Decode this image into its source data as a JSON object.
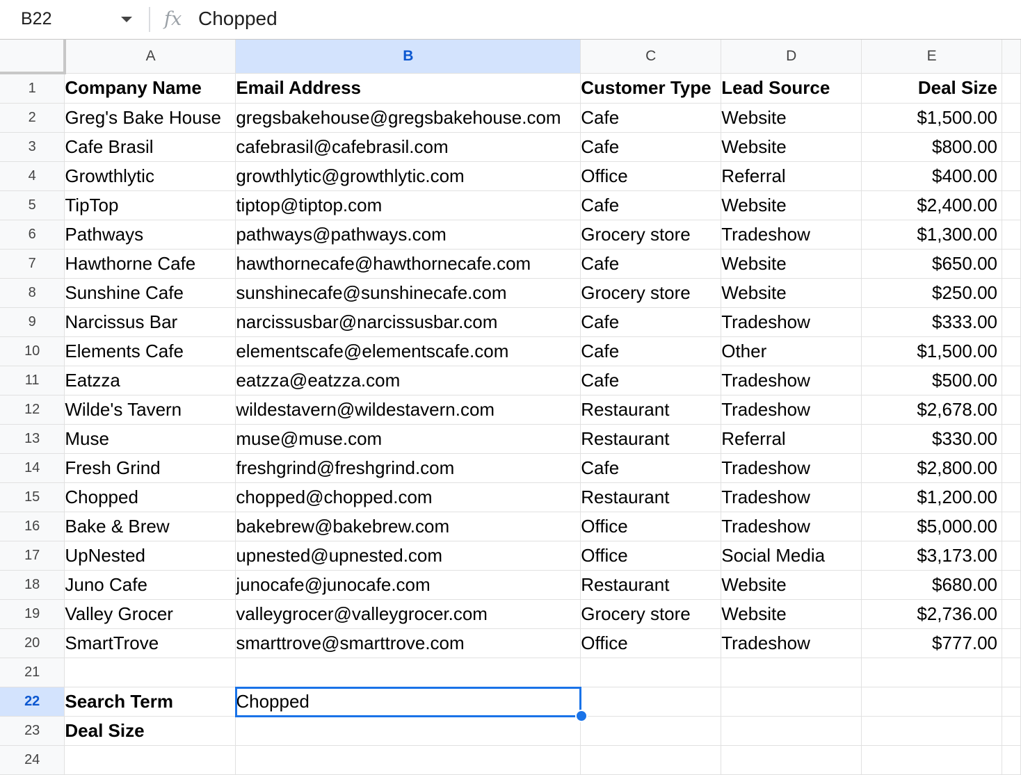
{
  "formula_bar": {
    "cell_ref": "B22",
    "fx_icon": "fx-icon",
    "content": "Chopped"
  },
  "columns": [
    "A",
    "B",
    "C",
    "D",
    "E"
  ],
  "selected_column": "B",
  "selected_row": "22",
  "rows": [
    {
      "num": "1",
      "cells": [
        "Company Name",
        "Email Address",
        "Customer Type",
        "Lead Source",
        "Deal Size"
      ]
    },
    {
      "num": "2",
      "cells": [
        "Greg's Bake House",
        "gregsbakehouse@gregsbakehouse.com",
        "Cafe",
        "Website",
        "$1,500.00"
      ]
    },
    {
      "num": "3",
      "cells": [
        "Cafe Brasil",
        "cafebrasil@cafebrasil.com",
        "Cafe",
        "Website",
        "$800.00"
      ]
    },
    {
      "num": "4",
      "cells": [
        "Growthlytic",
        "growthlytic@growthlytic.com",
        "Office",
        "Referral",
        "$400.00"
      ]
    },
    {
      "num": "5",
      "cells": [
        "TipTop",
        "tiptop@tiptop.com",
        "Cafe",
        "Website",
        "$2,400.00"
      ]
    },
    {
      "num": "6",
      "cells": [
        "Pathways",
        "pathways@pathways.com",
        "Grocery store",
        "Tradeshow",
        "$1,300.00"
      ]
    },
    {
      "num": "7",
      "cells": [
        "Hawthorne Cafe",
        "hawthornecafe@hawthornecafe.com",
        "Cafe",
        "Website",
        "$650.00"
      ]
    },
    {
      "num": "8",
      "cells": [
        "Sunshine Cafe",
        "sunshinecafe@sunshinecafe.com",
        "Grocery store",
        "Website",
        "$250.00"
      ]
    },
    {
      "num": "9",
      "cells": [
        "Narcissus Bar",
        "narcissusbar@narcissusbar.com",
        "Cafe",
        "Tradeshow",
        "$333.00"
      ]
    },
    {
      "num": "10",
      "cells": [
        "Elements Cafe",
        "elementscafe@elementscafe.com",
        "Cafe",
        "Other",
        "$1,500.00"
      ]
    },
    {
      "num": "11",
      "cells": [
        "Eatzza",
        "eatzza@eatzza.com",
        "Cafe",
        "Tradeshow",
        "$500.00"
      ]
    },
    {
      "num": "12",
      "cells": [
        "Wilde's Tavern",
        "wildestavern@wildestavern.com",
        "Restaurant",
        "Tradeshow",
        "$2,678.00"
      ]
    },
    {
      "num": "13",
      "cells": [
        "Muse",
        "muse@muse.com",
        "Restaurant",
        "Referral",
        "$330.00"
      ]
    },
    {
      "num": "14",
      "cells": [
        "Fresh Grind",
        "freshgrind@freshgrind.com",
        "Cafe",
        "Tradeshow",
        "$2,800.00"
      ]
    },
    {
      "num": "15",
      "cells": [
        "Chopped",
        "chopped@chopped.com",
        "Restaurant",
        "Tradeshow",
        "$1,200.00"
      ]
    },
    {
      "num": "16",
      "cells": [
        "Bake & Brew",
        "bakebrew@bakebrew.com",
        "Office",
        "Tradeshow",
        "$5,000.00"
      ]
    },
    {
      "num": "17",
      "cells": [
        "UpNested",
        "upnested@upnested.com",
        "Office",
        "Social Media",
        "$3,173.00"
      ]
    },
    {
      "num": "18",
      "cells": [
        "Juno Cafe",
        "junocafe@junocafe.com",
        "Restaurant",
        "Website",
        "$680.00"
      ]
    },
    {
      "num": "19",
      "cells": [
        "Valley Grocer",
        "valleygrocer@valleygrocer.com",
        "Grocery store",
        "Website",
        "$2,736.00"
      ]
    },
    {
      "num": "20",
      "cells": [
        "SmartTrove",
        "smarttrove@smarttrove.com",
        "Office",
        "Tradeshow",
        "$777.00"
      ]
    },
    {
      "num": "21",
      "cells": [
        "",
        "",
        "",
        "",
        ""
      ]
    },
    {
      "num": "22",
      "cells": [
        "Search Term",
        "Chopped",
        "",
        "",
        ""
      ]
    },
    {
      "num": "23",
      "cells": [
        "Deal Size",
        "",
        "",
        "",
        ""
      ]
    },
    {
      "num": "24",
      "cells": [
        "",
        "",
        "",
        "",
        ""
      ]
    }
  ]
}
